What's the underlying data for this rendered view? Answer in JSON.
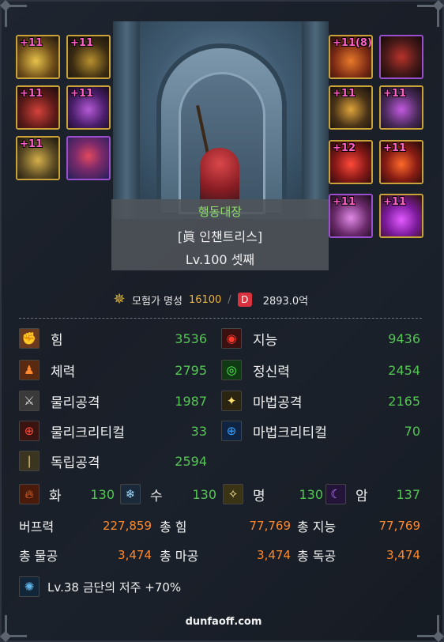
{
  "colors": {
    "stat_value": "#53c653",
    "buff_value": "#ff8a2a",
    "enh_text": "#ff5ec8",
    "guild": "#8fe06a",
    "fame_value": "#f2b23c"
  },
  "equipment": {
    "left": [
      {
        "enh": "+11",
        "icon": "weapon-icon"
      },
      {
        "enh": "+11",
        "icon": "shoulder-armor-icon"
      },
      {
        "enh": "+11",
        "icon": "top-armor-icon"
      },
      {
        "enh": "+11",
        "icon": "bottom-armor-icon"
      },
      {
        "enh": "+11",
        "icon": "belt-icon"
      },
      {
        "enh": "",
        "icon": "creature-icon"
      }
    ],
    "right": [
      {
        "enh": "+11(8)",
        "icon": "title-icon"
      },
      {
        "enh": "",
        "icon": "aura-icon"
      },
      {
        "enh": "+11",
        "icon": "bracelet-icon"
      },
      {
        "enh": "+11",
        "icon": "necklace-icon"
      },
      {
        "enh": "+12",
        "icon": "ring-icon"
      },
      {
        "enh": "+11",
        "icon": "support-equipment-icon"
      },
      {
        "enh": "+11",
        "icon": "magic-stone-icon"
      },
      {
        "enh": "+11",
        "icon": "earring-icon"
      }
    ]
  },
  "character": {
    "guild": "행동대장",
    "title": "[眞 인챈트리스]",
    "level": "Lv.100 셋째"
  },
  "fame": {
    "label": "모험가 명성",
    "value": "16100",
    "sep": "/",
    "d_badge": "D",
    "dungeon_value": "2893.0억"
  },
  "stats": {
    "str": {
      "label": "힘",
      "value": "3536"
    },
    "int": {
      "label": "지능",
      "value": "9436"
    },
    "vit": {
      "label": "체력",
      "value": "2795"
    },
    "spr": {
      "label": "정신력",
      "value": "2454"
    },
    "patk": {
      "label": "물리공격",
      "value": "1987"
    },
    "matk": {
      "label": "마법공격",
      "value": "2165"
    },
    "pcrit": {
      "label": "물리크리티컬",
      "value": "33"
    },
    "mcrit": {
      "label": "마법크리티컬",
      "value": "70"
    },
    "indep": {
      "label": "독립공격",
      "value": "2594"
    }
  },
  "elements": {
    "fire": {
      "label": "화",
      "value": "130"
    },
    "water": {
      "label": "수",
      "value": "130"
    },
    "light": {
      "label": "명",
      "value": "130"
    },
    "dark": {
      "label": "암",
      "value": "137"
    }
  },
  "buff": {
    "buff_power": {
      "label": "버프력",
      "value": "227,859"
    },
    "total_str": {
      "label": "총 힘",
      "value": "77,769"
    },
    "total_int": {
      "label": "총 지능",
      "value": "77,769"
    },
    "total_patk": {
      "label": "총 물공",
      "value": "3,474"
    },
    "total_matk": {
      "label": "총 마공",
      "value": "3,474"
    },
    "total_indep": {
      "label": "총 독공",
      "value": "3,474"
    }
  },
  "curse": {
    "label": "Lv.38 금단의 저주 +70%"
  },
  "footer": {
    "site": "dunfaoff.com"
  }
}
